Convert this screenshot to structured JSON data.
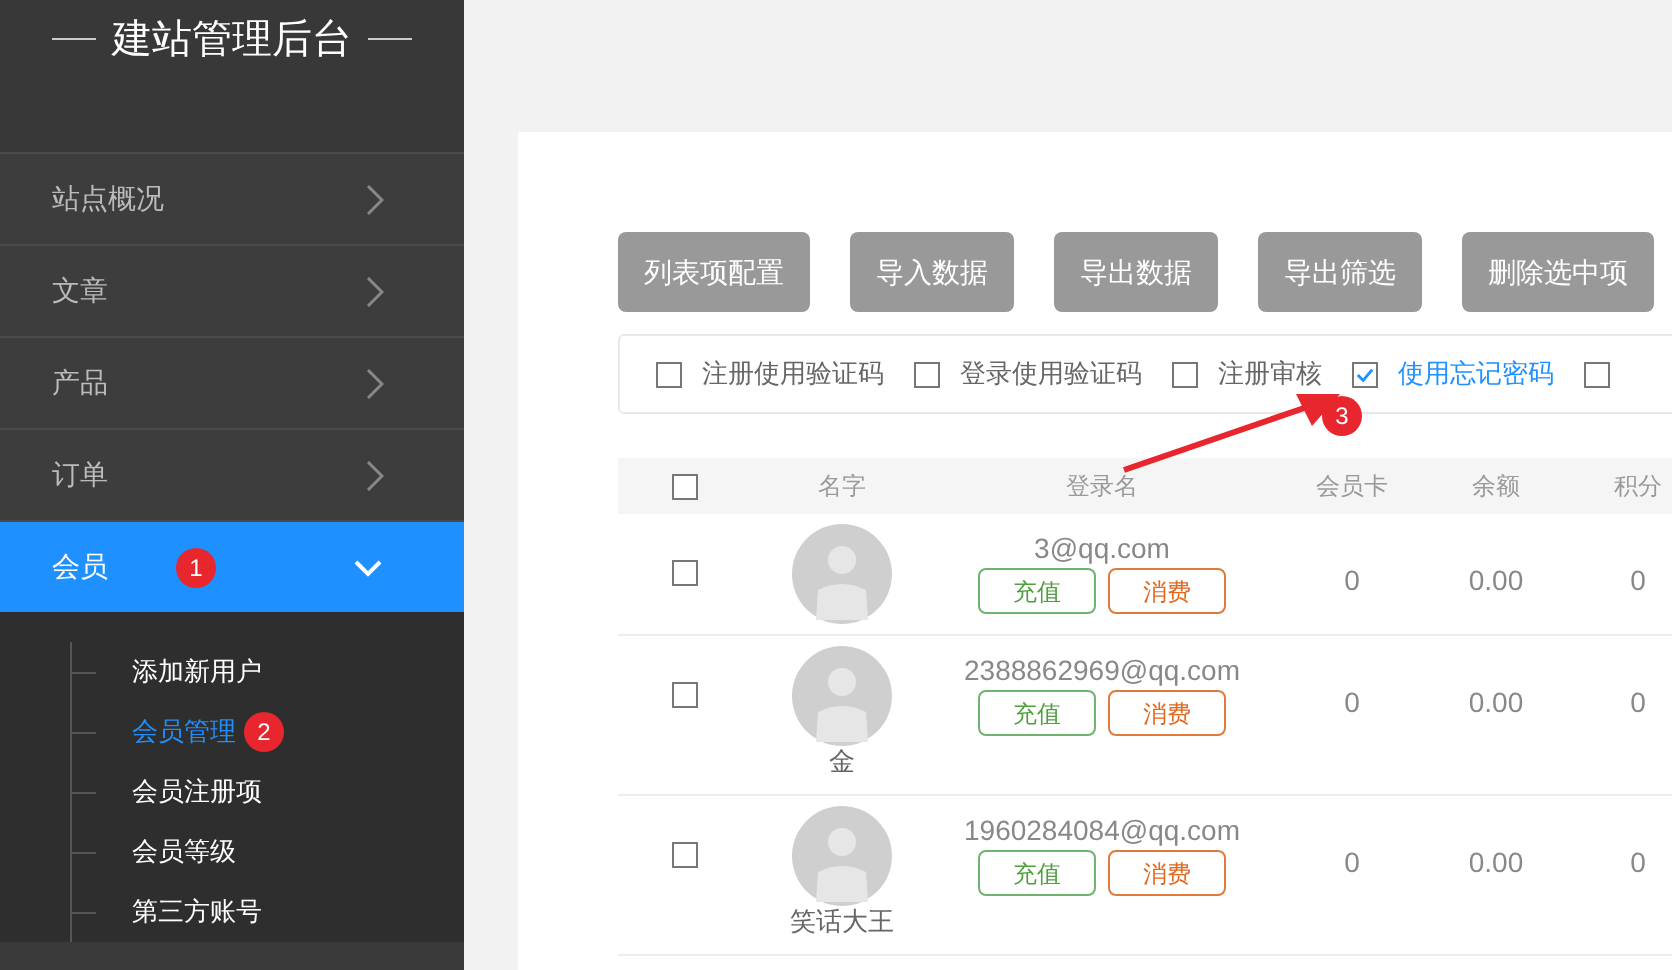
{
  "sidebar": {
    "title": "建站管理后台",
    "items": [
      {
        "label": "站点概况",
        "expanded": false,
        "selected": false
      },
      {
        "label": "文章",
        "expanded": false,
        "selected": false
      },
      {
        "label": "产品",
        "expanded": false,
        "selected": false
      },
      {
        "label": "订单",
        "expanded": false,
        "selected": false
      },
      {
        "label": "会员",
        "expanded": true,
        "selected": true,
        "badge": "1",
        "children": [
          {
            "label": "添加新用户",
            "selected": false
          },
          {
            "label": "会员管理",
            "selected": true,
            "badge": "2"
          },
          {
            "label": "会员注册项",
            "selected": false
          },
          {
            "label": "会员等级",
            "selected": false
          },
          {
            "label": "第三方账号",
            "selected": false
          }
        ]
      }
    ]
  },
  "toolbar": {
    "buttons": [
      "列表项配置",
      "导入数据",
      "导出数据",
      "导出筛选",
      "删除选中项"
    ]
  },
  "options": [
    {
      "label": "注册使用验证码",
      "checked": false
    },
    {
      "label": "登录使用验证码",
      "checked": false
    },
    {
      "label": "注册审核",
      "checked": false
    },
    {
      "label": "使用忘记密码",
      "checked": true,
      "badge": "3"
    },
    {
      "checked": false
    }
  ],
  "table": {
    "select_all": {
      "checked": false
    },
    "columns": [
      "名字",
      "登录名",
      "会员卡",
      "余额",
      "积分"
    ],
    "rows": [
      {
        "checked": false,
        "name": "",
        "login": "3@qq.com",
        "actions": [
          "充值",
          "消费"
        ],
        "card": "0",
        "balance": "0.00",
        "points": "0"
      },
      {
        "checked": false,
        "name": "金",
        "login": "2388862969@qq.com",
        "actions": [
          "充值",
          "消费"
        ],
        "card": "0",
        "balance": "0.00",
        "points": "0"
      },
      {
        "checked": false,
        "name": "笑话大王",
        "login": "1960284084@qq.com",
        "actions": [
          "充值",
          "消费"
        ],
        "card": "0",
        "balance": "0.00",
        "points": "0"
      }
    ]
  }
}
